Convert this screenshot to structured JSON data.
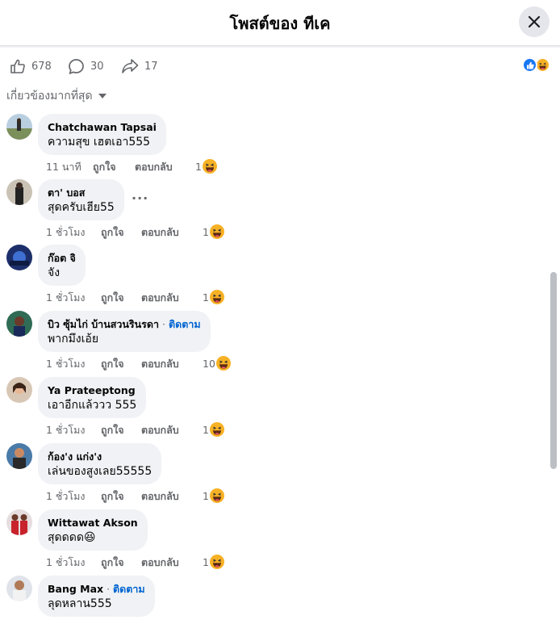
{
  "header": {
    "title": "โพสต์ของ ทีเค"
  },
  "stats": {
    "likes": "678",
    "comments": "30",
    "shares": "17"
  },
  "reactions_icons": [
    "like-icon",
    "haha-icon"
  ],
  "sort_label": "เกี่ยวข้องมากที่สุด",
  "colors": {
    "accent": "#1877f2",
    "follow": "#0064d1",
    "bubble": "#f0f2f5",
    "muted": "#65676b"
  },
  "comments": [
    {
      "author": "Chatchawan Tapsai",
      "follow": "",
      "text": "ความสุข เฮตเอา555",
      "time": "11 นาที",
      "like": "ถูกใจ",
      "reply": "ตอบกลับ",
      "reactions": "1"
    },
    {
      "author": "ตา' บอส",
      "follow": "",
      "text": "สุดครับเฮีย55",
      "time": "1 ชั่วโมง",
      "like": "ถูกใจ",
      "reply": "ตอบกลับ",
      "reactions": "1",
      "more": "···"
    },
    {
      "author": "ก๊อต จิ",
      "author2": "จัง",
      "follow": "",
      "text": "",
      "time": "1 ชั่วโมง",
      "like": "ถูกใจ",
      "reply": "ตอบกลับ",
      "reactions": "1"
    },
    {
      "author": "บิว ซุ้มไก่ บ้านสวนรินรดา",
      "follow": "ติดตาม",
      "text": "พากมึงเอ้ย",
      "time": "1 ชั่วโมง",
      "like": "ถูกใจ",
      "reply": "ตอบกลับ",
      "reactions": "10"
    },
    {
      "author": "Ya Prateeptong",
      "follow": "",
      "text": "เอาอีกแล้ววว 555",
      "time": "1 ชั่วโมง",
      "like": "ถูกใจ",
      "reply": "ตอบกลับ",
      "reactions": "1"
    },
    {
      "author": "ก้อง'ง แก่ง'ง",
      "follow": "",
      "text": "เล่นของสูงเลย55555",
      "time": "1 ชั่วโมง",
      "like": "ถูกใจ",
      "reply": "ตอบกลับ",
      "reactions": "1"
    },
    {
      "author": "Wittawat Akson",
      "follow": "",
      "text": "สุดดดด",
      "text_emoji": "😆",
      "time": "1 ชั่วโมง",
      "like": "ถูกใจ",
      "reply": "ตอบกลับ",
      "reactions": "1"
    },
    {
      "author": "Bang Max",
      "follow": "ติดตาม",
      "text": "ลุดหลาน555",
      "time": "",
      "like": "",
      "reply": "",
      "reactions": ""
    }
  ]
}
